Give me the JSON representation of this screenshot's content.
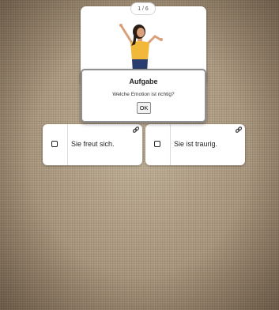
{
  "page_counter": "1 / 6",
  "task": {
    "title": "Aufgabe",
    "question": "Welche Emotion ist richtig?",
    "ok_label": "OK"
  },
  "answers": [
    {
      "label": "Sie freut sich.",
      "icon": "link-icon"
    },
    {
      "label": "Sie ist traurig.",
      "icon": "link-icon"
    }
  ],
  "colors": {
    "background": "#a8957b",
    "card": "#ffffff",
    "dialog_border": "#8f8f8f",
    "shirt": "#f2b83a",
    "pants": "#2b3d6e",
    "skin": "#d9a07a",
    "hair": "#2a1d16"
  }
}
